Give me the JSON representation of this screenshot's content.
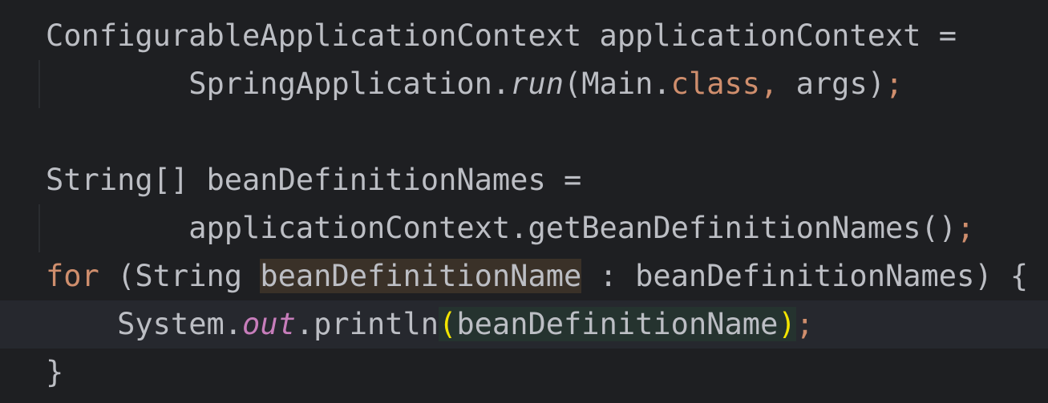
{
  "editor": {
    "lines": [
      {
        "tokens": [
          {
            "text": "ConfigurableApplicationContext applicationContext =",
            "type": "plain"
          }
        ]
      },
      {
        "tokens": [
          {
            "text": "        SpringApplication.",
            "type": "plain"
          },
          {
            "text": "run",
            "type": "static-method"
          },
          {
            "text": "(Main.",
            "type": "plain"
          },
          {
            "text": "class",
            "type": "kw"
          },
          {
            "text": ",",
            "type": "kw"
          },
          {
            "text": " args)",
            "type": "plain"
          },
          {
            "text": ";",
            "type": "semi"
          }
        ]
      },
      {
        "tokens": []
      },
      {
        "tokens": [
          {
            "text": "String[] beanDefinitionNames =",
            "type": "plain"
          }
        ]
      },
      {
        "tokens": [
          {
            "text": "        applicationContext.getBeanDefinitionNames()",
            "type": "plain"
          },
          {
            "text": ";",
            "type": "semi"
          }
        ]
      },
      {
        "tokens": [
          {
            "text": "for",
            "type": "kw"
          },
          {
            "text": " (String ",
            "type": "plain"
          },
          {
            "text": "beanDefinitionName",
            "type": "decl-hl"
          },
          {
            "text": " : beanDefinitionNames) {",
            "type": "plain"
          }
        ]
      },
      {
        "tokens": [
          {
            "text": "    System.",
            "type": "plain"
          },
          {
            "text": "out",
            "type": "field-static"
          },
          {
            "text": ".println",
            "type": "plain"
          },
          {
            "text": "(",
            "type": "brace-match-usage"
          },
          {
            "text": "beanDefinitionName",
            "type": "usage-hl"
          },
          {
            "text": ")",
            "type": "brace-match-usage"
          },
          {
            "text": ";",
            "type": "semi"
          }
        ]
      },
      {
        "tokens": [
          {
            "text": "}",
            "type": "plain"
          }
        ]
      }
    ],
    "current_line_index": 6,
    "colors": {
      "background": "#1e1f22",
      "current_line": "#26282e",
      "text": "#bcbec4",
      "keyword": "#cf8e6d",
      "static_field": "#c77dbb",
      "brace_match": "#f2e400",
      "declaration_highlight": "#3a3128",
      "usage_highlight": "#25332f"
    }
  }
}
